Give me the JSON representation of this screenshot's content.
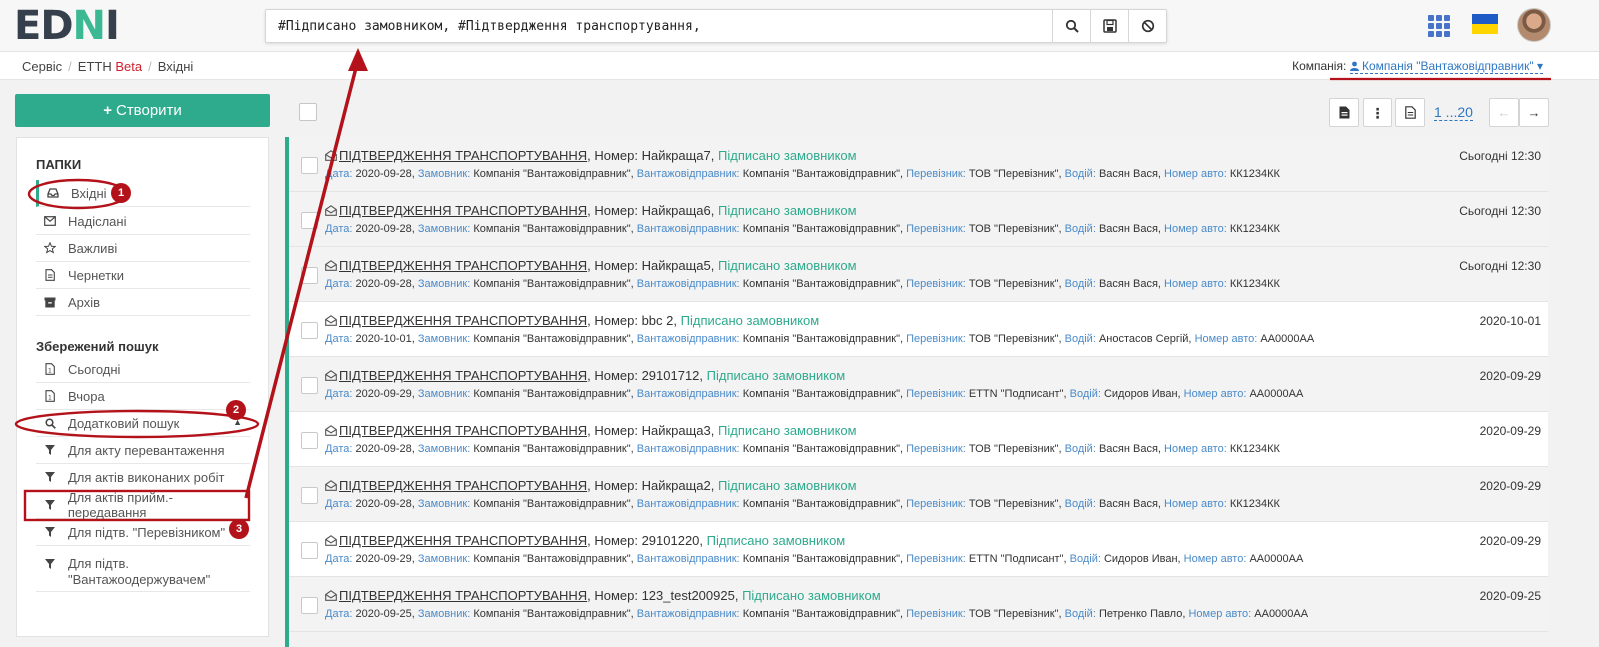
{
  "logo": {
    "left": "ED",
    "n": "N",
    "right": "I"
  },
  "search": {
    "value": "#Підписано замовником, #Підтвердження транспортування,"
  },
  "breadcrumb": {
    "items": [
      "Сервіс",
      "ЕТТН",
      "Вхідні"
    ],
    "beta": "Beta"
  },
  "company": {
    "label": "Компанія:",
    "value": "Компанія \"Вантажовідправник\""
  },
  "sidebar": {
    "create_label": "Створити",
    "folders_heading": "ПАПКИ",
    "folders": [
      {
        "label": "Вхідні",
        "icon": "inbox-icon"
      },
      {
        "label": "Надіслані",
        "icon": "envelope-icon"
      },
      {
        "label": "Важливі",
        "icon": "star-icon"
      },
      {
        "label": "Чернетки",
        "icon": "file-icon"
      },
      {
        "label": "Архів",
        "icon": "archive-icon"
      }
    ],
    "saved_heading": "Збережений пошук",
    "saved": [
      {
        "label": "Сьогодні",
        "icon": "file-icon"
      },
      {
        "label": "Вчора",
        "icon": "file-icon"
      },
      {
        "label": "Додатковий пошук",
        "icon": "search-icon"
      },
      {
        "label": "Для акту перевантаження",
        "icon": "filter-icon"
      },
      {
        "label": "Для актів виконаних робіт",
        "icon": "filter-icon"
      },
      {
        "label": "Для актів прийм.-передавання",
        "icon": "filter-icon"
      },
      {
        "label": "Для підтв. \"Перевізником\"",
        "icon": "filter-icon"
      },
      {
        "label": "Для підтв. \"Вантажоодержувачем\"",
        "icon": "filter-icon"
      }
    ]
  },
  "pager": {
    "range": "1 ...20"
  },
  "keys": {
    "date": "Дата:",
    "customer": "Замовник:",
    "shipper": "Вантажовідправник:",
    "carrier": "Перевізник:",
    "driver": "Водій:",
    "plate": "Номер авто:"
  },
  "documents": [
    {
      "title": "ПІДТВЕРДЖЕННЯ ТРАНСПОРТУВАННЯ",
      "number": ", Номер: Найкраща7,",
      "status": "Підписано замовником",
      "date": "2020-09-28,",
      "customer": "Компанія \"Вантажовідправник\",",
      "shipper": "Компанія \"Вантажовідправник\",",
      "carrier": "ТОВ \"Перевізник\",",
      "driver": "Васян Вася,",
      "plate": "КК1234КК",
      "when": "Сьогодні 12:30"
    },
    {
      "title": "ПІДТВЕРДЖЕННЯ ТРАНСПОРТУВАННЯ",
      "number": ", Номер: Найкраща6,",
      "status": "Підписано замовником",
      "date": "2020-09-28,",
      "customer": "Компанія \"Вантажовідправник\",",
      "shipper": "Компанія \"Вантажовідправник\",",
      "carrier": "ТОВ \"Перевізник\",",
      "driver": "Васян Вася,",
      "plate": "КК1234КК",
      "when": "Сьогодні 12:30"
    },
    {
      "title": "ПІДТВЕРДЖЕННЯ ТРАНСПОРТУВАННЯ",
      "number": ", Номер: Найкраща5,",
      "status": "Підписано замовником",
      "date": "2020-09-28,",
      "customer": "Компанія \"Вантажовідправник\",",
      "shipper": "Компанія \"Вантажовідправник\",",
      "carrier": "ТОВ \"Перевізник\",",
      "driver": "Васян Вася,",
      "plate": "КК1234КК",
      "when": "Сьогодні 12:30"
    },
    {
      "title": "ПІДТВЕРДЖЕННЯ ТРАНСПОРТУВАННЯ",
      "number": ", Номер: bbc 2,",
      "status": "Підписано замовником",
      "date": "2020-10-01,",
      "customer": "Компанія \"Вантажовідправник\",",
      "shipper": "Компанія \"Вантажовідправник\",",
      "carrier": "ТОВ \"Перевізник\",",
      "driver": "Аностасов Сергій,",
      "plate": "АА0000АА",
      "when": "2020-10-01"
    },
    {
      "title": "ПІДТВЕРДЖЕННЯ ТРАНСПОРТУВАННЯ",
      "number": ", Номер: 29101712,",
      "status": "Підписано замовником",
      "date": "2020-09-29,",
      "customer": "Компанія \"Вантажовідправник\",",
      "shipper": "Компанія \"Вантажовідправник\",",
      "carrier": "ЕТТN \"Подписант\",",
      "driver": "Сидоров Иван,",
      "plate": "АА0000АА",
      "when": "2020-09-29"
    },
    {
      "title": "ПІДТВЕРДЖЕННЯ ТРАНСПОРТУВАННЯ",
      "number": ", Номер: Найкраща3,",
      "status": "Підписано замовником",
      "date": "2020-09-28,",
      "customer": "Компанія \"Вантажовідправник\",",
      "shipper": "Компанія \"Вантажовідправник\",",
      "carrier": "ТОВ \"Перевізник\",",
      "driver": "Васян Вася,",
      "plate": "КК1234КК",
      "when": "2020-09-29"
    },
    {
      "title": "ПІДТВЕРДЖЕННЯ ТРАНСПОРТУВАННЯ",
      "number": ", Номер: Найкраща2,",
      "status": "Підписано замовником",
      "date": "2020-09-28,",
      "customer": "Компанія \"Вантажовідправник\",",
      "shipper": "Компанія \"Вантажовідправник\",",
      "carrier": "ТОВ \"Перевізник\",",
      "driver": "Васян Вася,",
      "plate": "КК1234КК",
      "when": "2020-09-29"
    },
    {
      "title": "ПІДТВЕРДЖЕННЯ ТРАНСПОРТУВАННЯ",
      "number": ", Номер: 29101220,",
      "status": "Підписано замовником",
      "date": "2020-09-29,",
      "customer": "Компанія \"Вантажовідправник\",",
      "shipper": "Компанія \"Вантажовідправник\",",
      "carrier": "ЕТТN \"Подписант\",",
      "driver": "Сидоров Иван,",
      "plate": "АА0000АА",
      "when": "2020-09-29"
    },
    {
      "title": "ПІДТВЕРДЖЕННЯ ТРАНСПОРТУВАННЯ",
      "number": ", Номер: 123_test200925,",
      "status": "Підписано замовником",
      "date": "2020-09-25,",
      "customer": "Компанія \"Вантажовідправник\",",
      "shipper": "Компанія \"Вантажовідправник\",",
      "carrier": "ТОВ \"Перевізник\",",
      "driver": "Петренко Павло,",
      "plate": "АА0000АА",
      "when": "2020-09-25"
    }
  ],
  "annotations": [
    "1",
    "2",
    "3"
  ]
}
